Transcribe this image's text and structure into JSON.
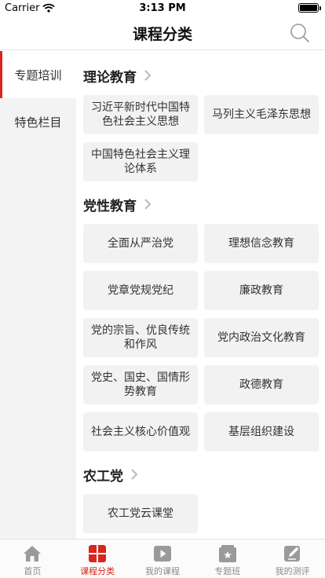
{
  "status_bar": {
    "carrier": "Carrier",
    "time": "3:13 PM"
  },
  "header": {
    "title": "课程分类"
  },
  "sidebar": {
    "items": [
      {
        "label": "专题培训",
        "active": true
      },
      {
        "label": "特色栏目",
        "active": false
      }
    ]
  },
  "sections": [
    {
      "title": "理论教育",
      "items": [
        "习近平新时代中国特色社会主义思想",
        "马列主义毛泽东思想",
        "中国特色社会主义理论体系"
      ]
    },
    {
      "title": "党性教育",
      "items": [
        "全面从严治党",
        "理想信念教育",
        "党章党规党纪",
        "廉政教育",
        "党的宗旨、优良传统和作风",
        "党内政治文化教育",
        "党史、国史、国情形势教育",
        "政德教育",
        "社会主义核心价值观",
        "基层组织建设"
      ]
    },
    {
      "title": "农工党",
      "items": [
        "农工党云课堂"
      ]
    }
  ],
  "tab_bar": {
    "tabs": [
      {
        "label": "首页",
        "icon": "home-icon",
        "active": false
      },
      {
        "label": "课程分类",
        "icon": "grid-icon",
        "active": true
      },
      {
        "label": "我的课程",
        "icon": "play-icon",
        "active": false
      },
      {
        "label": "专题班",
        "icon": "class-board-icon",
        "active": false
      },
      {
        "label": "我的测评",
        "icon": "edit-icon",
        "active": false
      }
    ]
  },
  "colors": {
    "accent": "#d7261e",
    "inactive": "#8a8a8a",
    "sidebar_bg": "#f3f3f3",
    "card_bg": "#f2f2f2"
  }
}
